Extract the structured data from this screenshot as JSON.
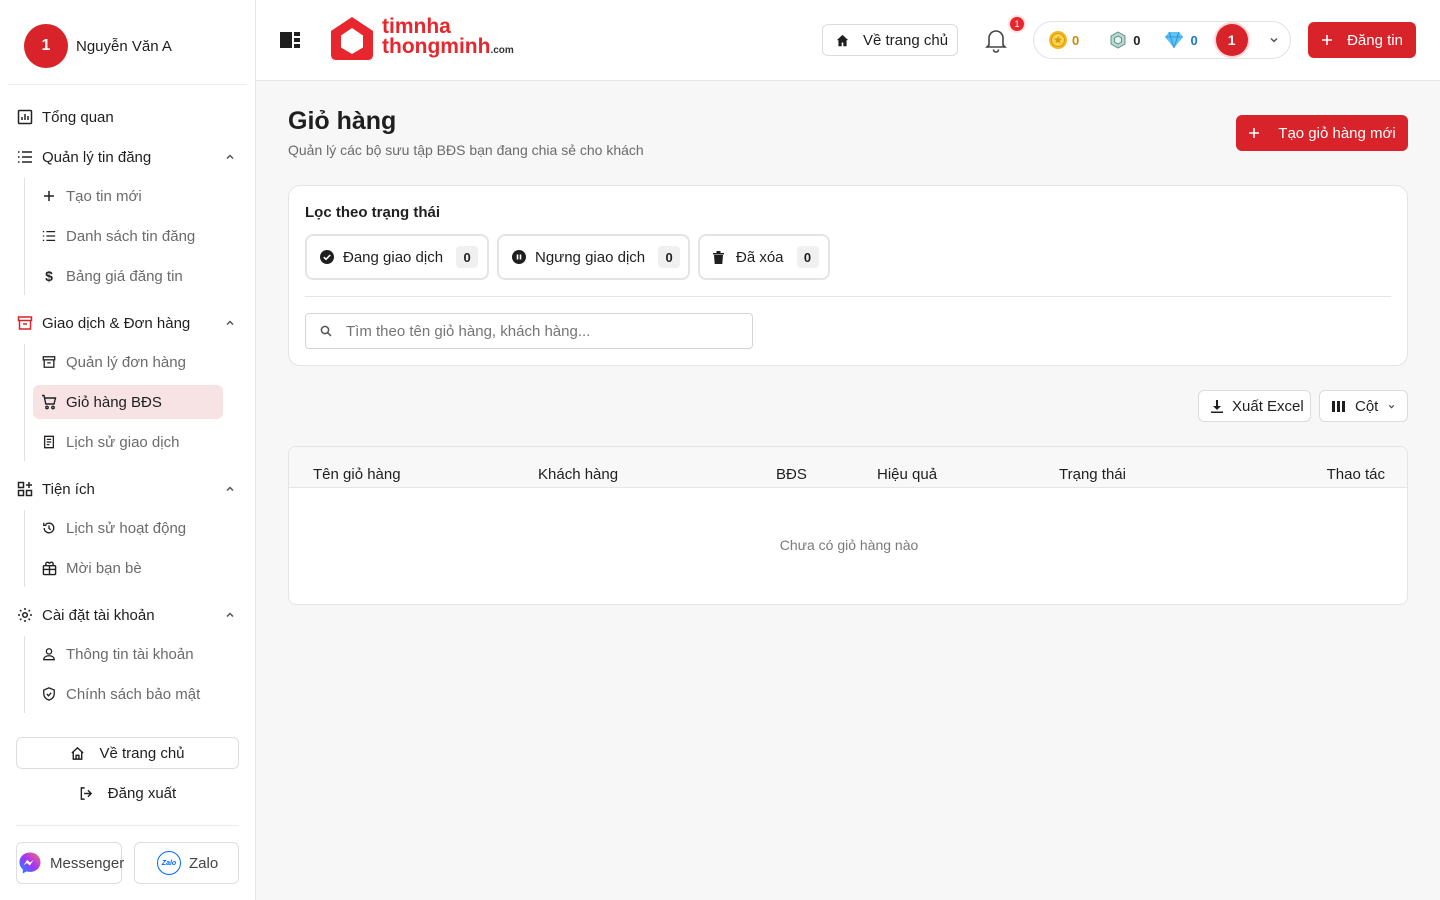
{
  "user": {
    "avatar_initial": "1",
    "name": "Nguyễn Văn A"
  },
  "sidebar": {
    "groups": [
      {
        "label": "Tổng quan"
      },
      {
        "label": "Quản lý tin đăng",
        "items": [
          {
            "label": "Tạo tin mới"
          },
          {
            "label": "Danh sách tin đăng"
          },
          {
            "label": "Bảng giá đăng tin"
          }
        ]
      },
      {
        "label": "Giao dịch & Đơn hàng",
        "items": [
          {
            "label": "Quản lý đơn hàng"
          },
          {
            "label": "Giỏ hàng BĐS"
          },
          {
            "label": "Lịch sử giao dịch"
          }
        ]
      },
      {
        "label": "Tiện ích",
        "items": [
          {
            "label": "Lịch sử hoạt động"
          },
          {
            "label": "Mời bạn bè"
          }
        ]
      },
      {
        "label": "Cài đặt tài khoản",
        "items": [
          {
            "label": "Thông tin tài khoản"
          },
          {
            "label": "Chính sách bảo mật"
          }
        ]
      }
    ],
    "home_label": "Về trang chủ",
    "logout_label": "Đăng xuất",
    "messenger_label": "Messenger",
    "zalo_label": "Zalo",
    "zalo_icon_text": "Zalo"
  },
  "header": {
    "logo_top": "timnha",
    "logo_bottom": "thongminh",
    "logo_suffix": ".com",
    "home_label": "Về trang chủ",
    "notification_count": "1",
    "wallet": {
      "coin": "0",
      "hex": "0",
      "diamond": "0"
    },
    "avatar_initial": "1",
    "post_label": "Đăng tin"
  },
  "page": {
    "title": "Giỏ hàng",
    "subtitle": "Quản lý các bộ sưu tập BĐS bạn đang chia sẻ cho khách",
    "create_label": "Tạo giỏ hàng mới"
  },
  "filter": {
    "title": "Lọc theo trạng thái",
    "chips": [
      {
        "label": "Đang giao dịch",
        "count": "0"
      },
      {
        "label": "Ngưng giao dịch",
        "count": "0"
      },
      {
        "label": "Đã xóa",
        "count": "0"
      }
    ],
    "search_placeholder": "Tìm theo tên giỏ hàng, khách hàng..."
  },
  "toolbar": {
    "export_label": "Xuất Excel",
    "columns_label": "Cột"
  },
  "table": {
    "headers": [
      "Tên giỏ hàng",
      "Khách hàng",
      "BĐS",
      "Hiệu quả",
      "Trạng thái",
      "Thao tác"
    ],
    "empty_text": "Chưa có giỏ hàng nào"
  },
  "colors": {
    "brand": "#d8232a",
    "active_bg": "#f7e3e4"
  }
}
